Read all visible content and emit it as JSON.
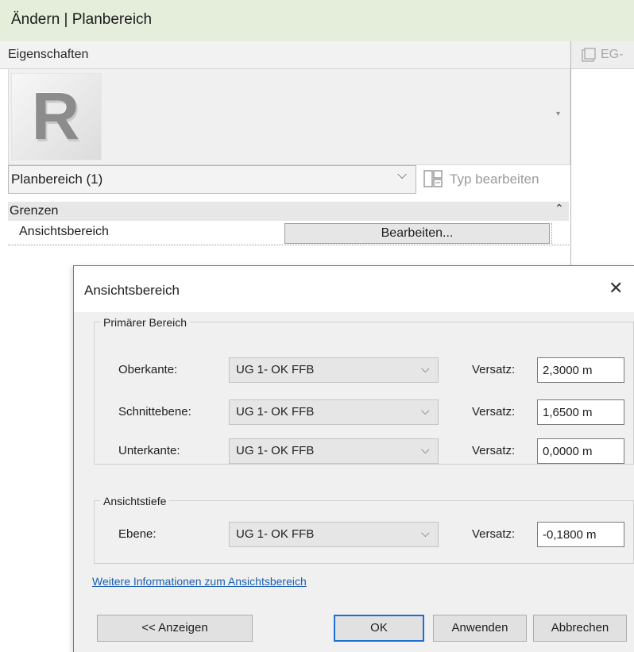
{
  "ribbon": {
    "title": "Ändern | Planbereich"
  },
  "properties": {
    "title": "Eigenschaften",
    "logo_letter": "R",
    "type_selector": {
      "value": "Planbereich (1)"
    },
    "edit_type_label": "Typ bearbeiten",
    "group": {
      "label": "Grenzen"
    },
    "params": [
      {
        "label": "Ansichtsbereich",
        "button_label": "Bearbeiten..."
      }
    ]
  },
  "view_tab": {
    "label": "EG-"
  },
  "dialog": {
    "title": "Ansichtsbereich",
    "primary": {
      "legend": "Primärer Bereich",
      "rows": [
        {
          "label": "Oberkante:",
          "level": "UG 1- OK FFB",
          "offset_label": "Versatz:",
          "offset": "2,3000 m"
        },
        {
          "label": "Schnittebene:",
          "level": "UG 1- OK FFB",
          "offset_label": "Versatz:",
          "offset": "1,6500 m"
        },
        {
          "label": "Unterkante:",
          "level": "UG 1- OK FFB",
          "offset_label": "Versatz:",
          "offset": "0,0000 m"
        }
      ]
    },
    "depth": {
      "legend": "Ansichtstiefe",
      "rows": [
        {
          "label": "Ebene:",
          "level": "UG 1- OK FFB",
          "offset_label": "Versatz:",
          "offset": "-0,1800 m"
        }
      ]
    },
    "info_link": "Weitere Informationen zum Ansichtsbereich",
    "buttons": {
      "show": "<< Anzeigen",
      "ok": "OK",
      "apply": "Anwenden",
      "cancel": "Abbrechen"
    }
  },
  "colors": {
    "ribbon_bg": "#e4eedb",
    "link": "#1a5fb4",
    "default_button_border": "#1e6fd2"
  }
}
